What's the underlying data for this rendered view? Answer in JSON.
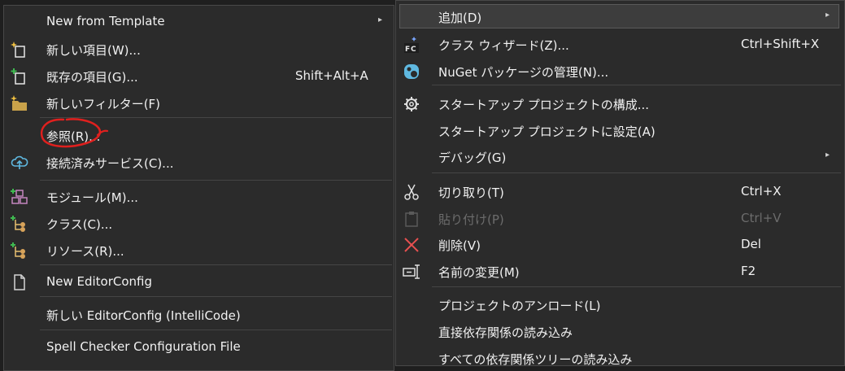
{
  "submenu": {
    "items": [
      {
        "label": "New from Template",
        "arrow": "▸"
      },
      {
        "label": "新しい項目(W)..."
      },
      {
        "label": "既存の項目(G)...",
        "shortcut": "Shift+Alt+A"
      },
      {
        "label": "新しいフィルター(F)"
      },
      {
        "label": "参照(R)..."
      },
      {
        "label": "接続済みサービス(C)..."
      },
      {
        "label": "モジュール(M)..."
      },
      {
        "label": "クラス(C)..."
      },
      {
        "label": "リソース(R)..."
      },
      {
        "label": "New EditorConfig"
      },
      {
        "label": "新しい EditorConfig (IntelliCode)"
      },
      {
        "label": "Spell Checker Configuration File"
      }
    ]
  },
  "mainmenu": {
    "items": [
      {
        "label": "追加(D)",
        "arrow": "▸"
      },
      {
        "label": "クラス ウィザード(Z)...",
        "shortcut": "Ctrl+Shift+X"
      },
      {
        "label": "NuGet パッケージの管理(N)..."
      },
      {
        "label": "スタートアップ プロジェクトの構成..."
      },
      {
        "label": "スタートアップ プロジェクトに設定(A)"
      },
      {
        "label": "デバッグ(G)",
        "arrow": "▸"
      },
      {
        "label": "切り取り(T)",
        "shortcut": "Ctrl+X"
      },
      {
        "label": "貼り付け(P)",
        "shortcut": "Ctrl+V"
      },
      {
        "label": "削除(V)",
        "shortcut": "Del"
      },
      {
        "label": "名前の変更(M)",
        "shortcut": "F2"
      },
      {
        "label": "プロジェクトのアンロード(L)"
      },
      {
        "label": "直接依存関係の読み込み"
      },
      {
        "label": "すべての依存関係ツリーの読み込み"
      }
    ]
  },
  "colors": {
    "menu_bg": "#2b2b2b",
    "text": "#f1f1f1",
    "disabled": "#6c6c6c",
    "annotation": "#e0201e"
  }
}
